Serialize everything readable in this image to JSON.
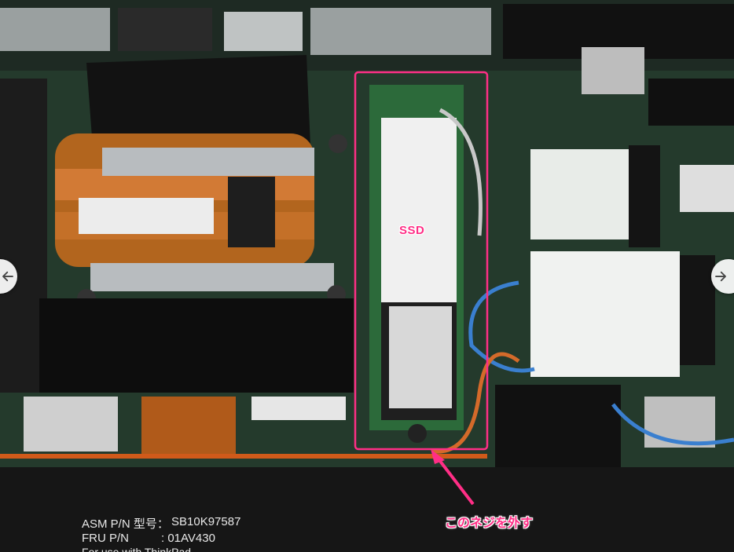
{
  "annotations": {
    "ssd_label": "SSD",
    "screw_label": "このネジを外す",
    "highlight_color": "#ff2e86"
  },
  "labels": {
    "asm_key": "ASM P/N 型号：",
    "asm_value": "SB10K97587",
    "fru_key": "FRU P/N",
    "fru_value": ": 01AV430",
    "footer": "For use with ThinkPad"
  },
  "nav": {
    "prev_icon": "arrow-left-icon",
    "next_icon": "arrow-right-icon"
  }
}
